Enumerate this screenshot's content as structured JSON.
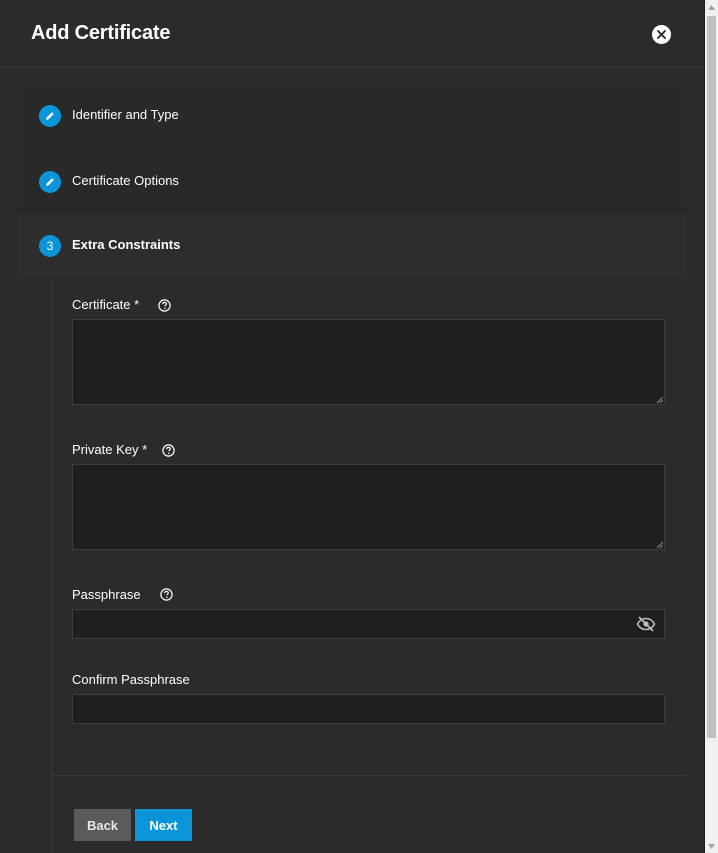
{
  "dialog": {
    "title": "Add Certificate"
  },
  "steps": [
    {
      "label": "Identifier and Type",
      "marker": "edit-icon",
      "state": "completed"
    },
    {
      "label": "Certificate Options",
      "marker": "edit-icon",
      "state": "completed"
    },
    {
      "label": "Extra Constraints",
      "number": "3",
      "state": "active"
    }
  ],
  "fields": {
    "certificate": {
      "label": "Certificate *",
      "value": ""
    },
    "private_key": {
      "label": "Private Key *",
      "value": ""
    },
    "passphrase": {
      "label": "Passphrase",
      "value": ""
    },
    "confirm_passphrase": {
      "label": "Confirm Passphrase",
      "value": ""
    }
  },
  "buttons": {
    "back": "Back",
    "next": "Next"
  },
  "colors": {
    "accent": "#0b95d8",
    "background": "#2b2b2b",
    "input_bg": "#1f1f1f"
  }
}
